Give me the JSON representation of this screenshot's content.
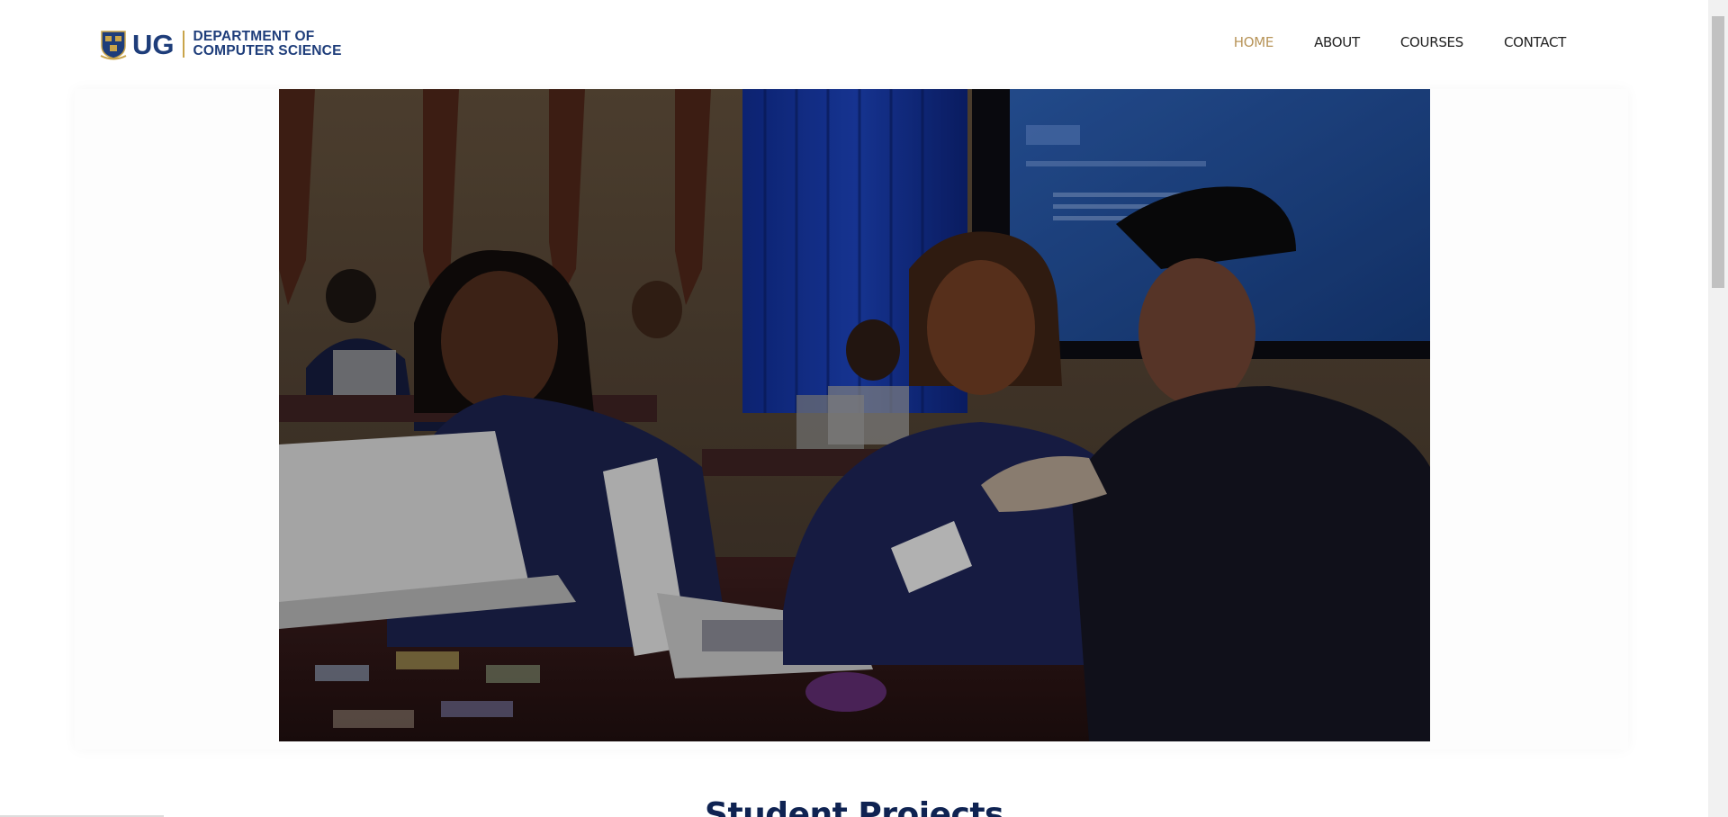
{
  "logo": {
    "mark": "UG",
    "line1": "DEPARTMENT OF",
    "line2": "COMPUTER SCIENCE",
    "crest_icon": "university-crest-icon"
  },
  "nav": {
    "items": [
      {
        "label": "HOME",
        "active": true
      },
      {
        "label": "ABOUT",
        "active": false
      },
      {
        "label": "COURSES",
        "active": false
      },
      {
        "label": "CONTACT",
        "active": false
      }
    ]
  },
  "hero": {
    "image": "students-coding-classroom-photo"
  },
  "section": {
    "title": "Student Projects"
  },
  "colors": {
    "brand_navy": "#1e3d7a",
    "active_nav": "#b8955a",
    "title": "#0f2352"
  }
}
